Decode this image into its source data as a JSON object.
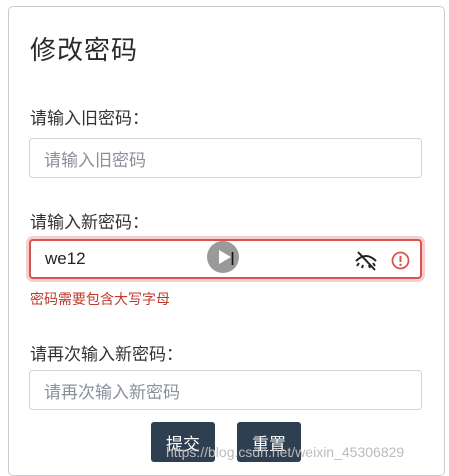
{
  "form": {
    "title": "修改密码",
    "old_password": {
      "label": "请输入旧密码：",
      "placeholder": "请输入旧密码",
      "value": ""
    },
    "new_password": {
      "label": "请输入新密码：",
      "value": "we12",
      "error": "密码需要包含大写字母",
      "icon": "eye-slash-icon",
      "status_icon": "alert-circle-icon"
    },
    "confirm_password": {
      "label": "请再次输入新密码：",
      "placeholder": "请再次输入新密码",
      "value": ""
    },
    "submit_label": "提交",
    "reset_label": "重置"
  },
  "overlay": {
    "play_icon": "play-icon",
    "caret": "I"
  },
  "watermark": "https://blog.csdn.net/weixin_45306829",
  "colors": {
    "error": "#d9534f",
    "button_bg": "#2f3f52",
    "border": "#ced4da"
  }
}
